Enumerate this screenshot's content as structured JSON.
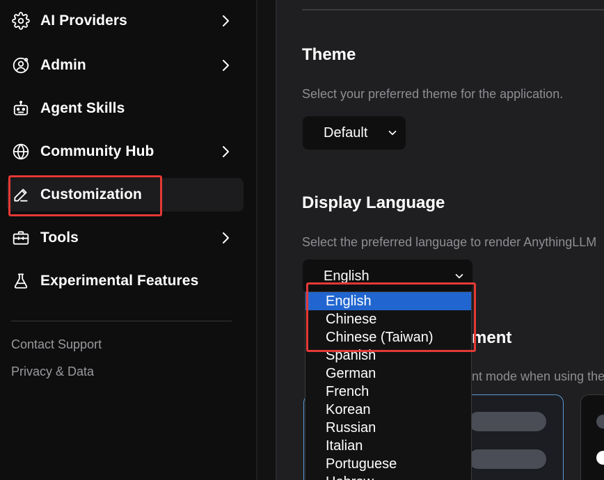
{
  "sidebar": {
    "items": [
      {
        "label": "AI Providers",
        "icon": "gear-icon",
        "has_chevron": true
      },
      {
        "label": "Admin",
        "icon": "user-gear-icon",
        "has_chevron": true
      },
      {
        "label": "Agent Skills",
        "icon": "robot-icon",
        "has_chevron": false
      },
      {
        "label": "Community Hub",
        "icon": "globe-icon",
        "has_chevron": true
      },
      {
        "label": "Customization",
        "icon": "pencil-icon",
        "has_chevron": false,
        "active": true
      },
      {
        "label": "Tools",
        "icon": "toolbox-icon",
        "has_chevron": true
      },
      {
        "label": "Experimental Features",
        "icon": "flask-icon",
        "has_chevron": false
      }
    ],
    "footer": {
      "contact": "Contact Support",
      "privacy": "Privacy & Data"
    }
  },
  "main": {
    "theme": {
      "title": "Theme",
      "description": "Select your preferred theme for the application.",
      "selected": "Default"
    },
    "language": {
      "title": "Display Language",
      "description": "Select the preferred language to render AnythingLLM",
      "selected": "English",
      "options": [
        "English",
        "Chinese",
        "Chinese (Taiwan)",
        "Spanish",
        "German",
        "French",
        "Korean",
        "Russian",
        "Italian",
        "Portuguese",
        "Hebrew"
      ]
    },
    "partial_section": {
      "title_fragment": "ment",
      "desc_fragment": "nt mode when using the"
    }
  },
  "colors": {
    "highlight": "#e53935",
    "selected_option": "#2166d0",
    "card_border_active": "#5a9bd5"
  }
}
